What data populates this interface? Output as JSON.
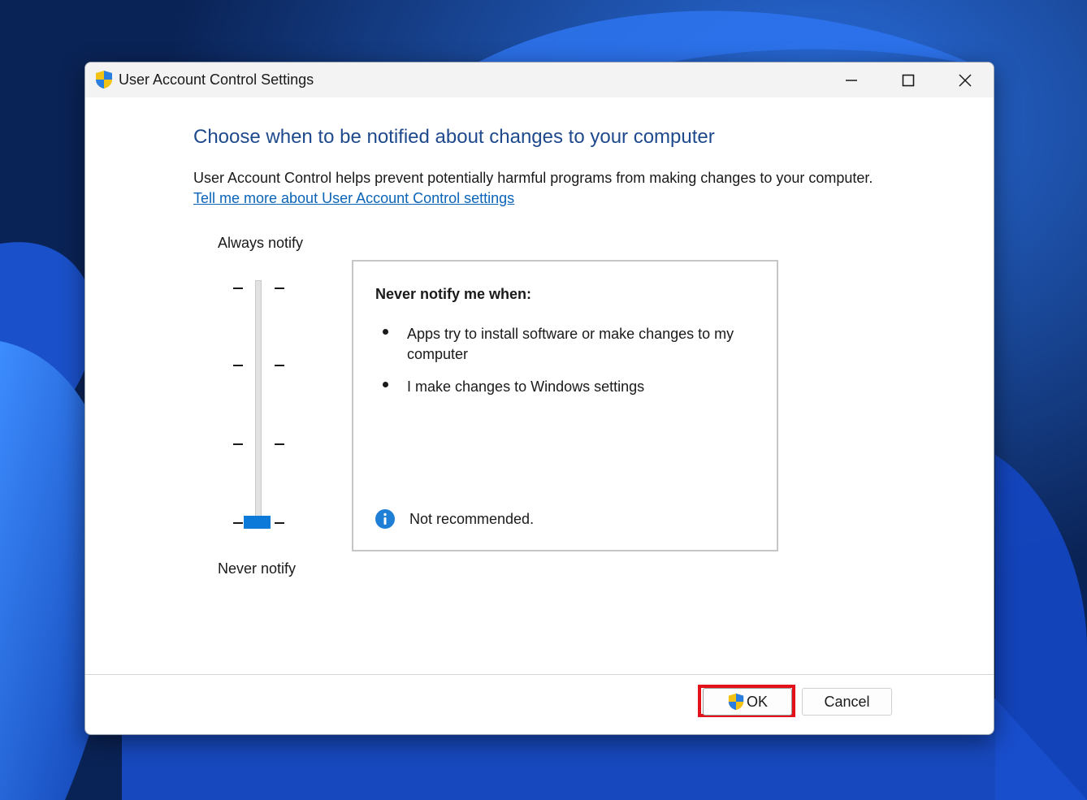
{
  "window": {
    "title": "User Account Control Settings",
    "controls": {
      "minimize_icon": "minimize-icon",
      "maximize_icon": "maximize-icon",
      "close_icon": "close-icon"
    }
  },
  "content": {
    "heading": "Choose when to be notified about changes to your computer",
    "description": "User Account Control helps prevent potentially harmful programs from making changes to your computer.",
    "learn_more_link": "Tell me more about User Account Control settings"
  },
  "slider": {
    "top_label": "Always notify",
    "bottom_label": "Never notify",
    "levels": 4,
    "selected_level": 1
  },
  "info_panel": {
    "heading": "Never notify me when:",
    "items": [
      "Apps try to install software or make changes to my computer",
      "I make changes to Windows settings"
    ],
    "note_icon": "info-icon",
    "note": "Not recommended."
  },
  "buttons": {
    "ok_label": "OK",
    "ok_icon": "uac-shield-icon",
    "cancel_label": "Cancel"
  },
  "colors": {
    "heading": "#1e4a8d",
    "link": "#0b64b8",
    "accent": "#0b7ad8",
    "highlight": "#e3121a"
  }
}
